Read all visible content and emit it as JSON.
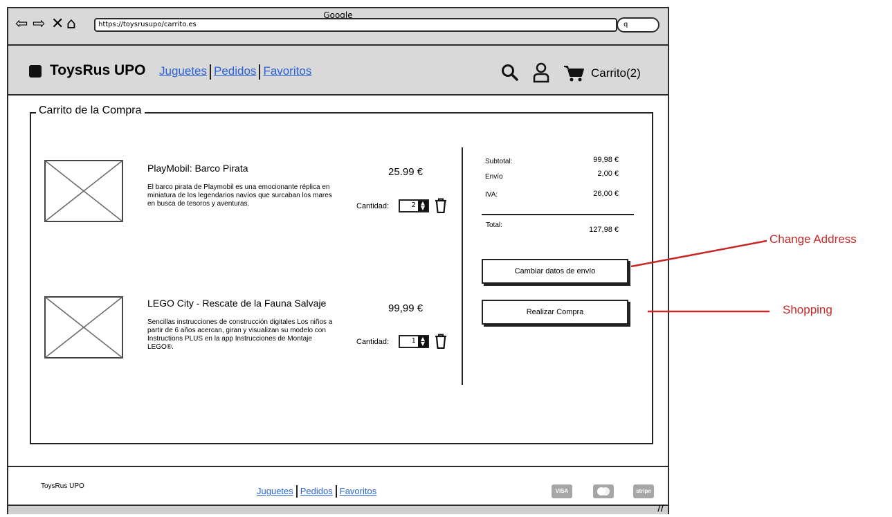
{
  "browser": {
    "window_title": "Google",
    "url": "https://toysrusupo/carrito.es",
    "search_glyph": "q"
  },
  "header": {
    "brand": "ToysRus UPO",
    "nav": [
      "Juguetes",
      "Pedidos",
      "Favoritos"
    ],
    "cart_label": "Carrito(2)"
  },
  "cart": {
    "legend": "Carrito de la Compra",
    "items": [
      {
        "title": "PlayMobil: Barco Pirata",
        "description": "El barco pirata de Playmobil es una emocionante réplica en miniatura de los legendarios navíos que surcaban los mares en busca de tesoros y aventuras.",
        "price": "25.99 €",
        "qty_label": "Cantidad:",
        "qty": "2"
      },
      {
        "title": "LEGO City - Rescate de la Fauna Salvaje",
        "description": "Sencillas instrucciones de construcción digitales Los niños a partir de 6 años acercan, giran y visualizan su modelo con Instructions PLUS en la app Instrucciones de Montaje LEGO®.",
        "price": "99,99 €",
        "qty_label": "Cantidad:",
        "qty": "1"
      }
    ]
  },
  "summary": {
    "subtotal_label": "Subtotal:",
    "subtotal_value": "99,98 €",
    "envio_label": "Envío",
    "envio_value": "2,00 €",
    "iva_label": "IVA:",
    "iva_value": "26,00 €",
    "total_label": "Total:",
    "total_value": "127,98 €"
  },
  "buttons": {
    "change_shipping": "Cambiar datos de envío",
    "checkout": "Realizar Compra"
  },
  "annotations": {
    "change_address": "Change Address",
    "shopping": "Shopping"
  },
  "footer": {
    "brand": "ToysRus UPO",
    "nav": [
      "Juguetes",
      "Pedidos",
      "Favoritos"
    ],
    "payments": [
      "VISA",
      "stripe"
    ]
  },
  "colors": {
    "chrome": "#d9d9d9",
    "link": "#2a62d8",
    "annotation": "#c62828"
  }
}
